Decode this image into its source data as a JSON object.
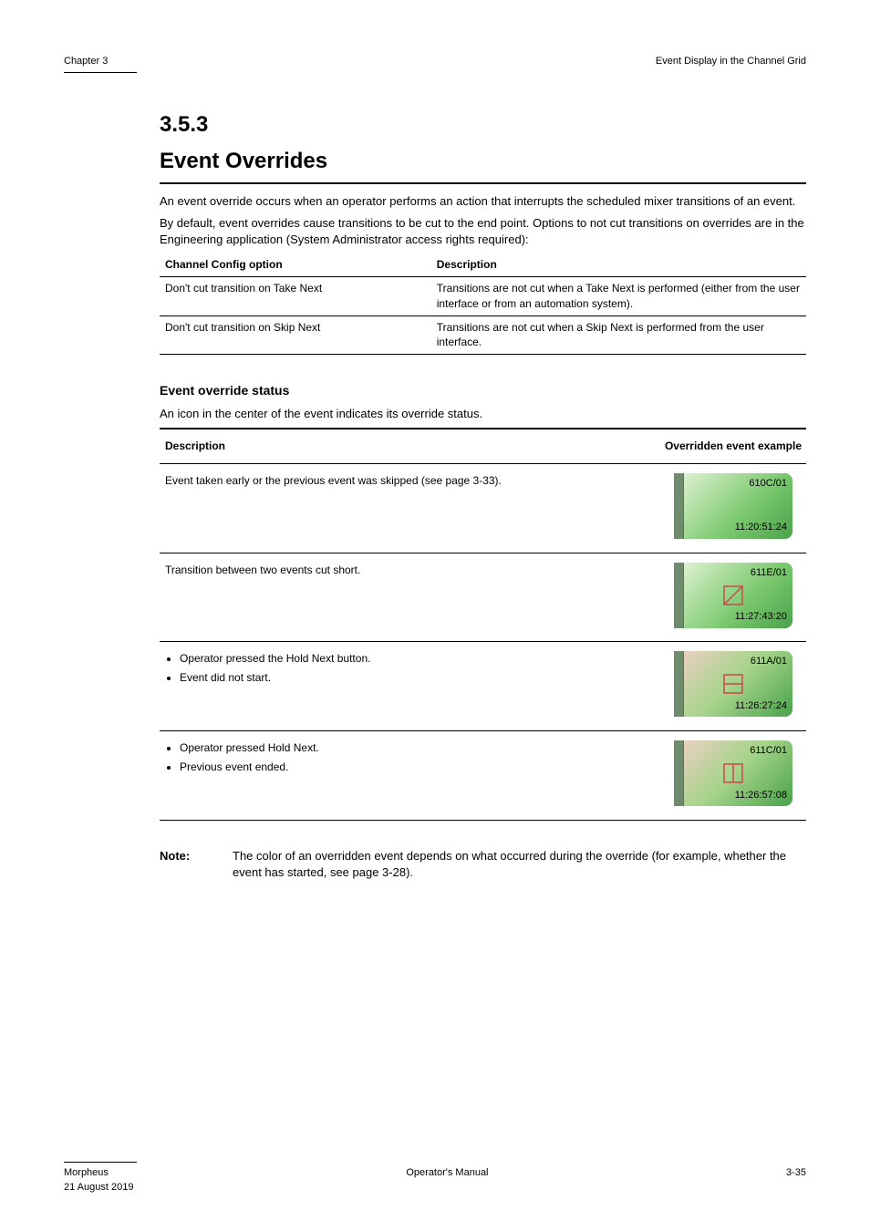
{
  "header": {
    "left": "Chapter 3",
    "right": "Event Display in the Channel Grid"
  },
  "section": {
    "number": "3.5.3",
    "title": "Event Overrides",
    "intro": "An event override occurs when an operator performs an action that interrupts the scheduled mixer transitions of an event.",
    "body": "By default, event overrides cause transitions to be cut to the end point. Options to not cut transitions on overrides are in the Engineering application (System Administrator access rights required):"
  },
  "opt_table": {
    "headers": [
      "Channel Config option",
      "Description"
    ],
    "rows": [
      [
        "Don't cut transition on Take Next",
        "Transitions are not cut when a Take Next is performed (either from the user interface or from an automation system)."
      ],
      [
        "Don't cut transition on Skip Next",
        "Transitions are not cut when a Skip Next is performed from the user interface."
      ]
    ]
  },
  "sub": {
    "title": "Event override status",
    "intro": "An icon in the center of the event indicates its override status.",
    "headers": [
      "Description",
      "Overridden event example"
    ],
    "rows": [
      {
        "desc_plain": "Event taken early or the previous event was skipped (see page 3-33).",
        "chip": {
          "style": "green",
          "title": "610C/01",
          "time": "11:20:51:24",
          "glyph": ""
        }
      },
      {
        "desc_plain": "Transition between two events cut short.",
        "chip": {
          "style": "green",
          "title": "611E/01",
          "time": "11:27:43:20",
          "glyph": "diag"
        }
      },
      {
        "desc_list": [
          "Operator pressed the Hold Next button.",
          "Event did not start."
        ],
        "chip": {
          "style": "redtint",
          "title": "611A/01",
          "time": "11:26:27:24",
          "glyph": "hsplit"
        }
      },
      {
        "desc_list": [
          "Operator pressed Hold Next.",
          "Previous event ended."
        ],
        "chip": {
          "style": "redtint",
          "title": "611C/01",
          "time": "11:26:57:08",
          "glyph": "vsplit"
        }
      }
    ]
  },
  "note": {
    "label": "Note:",
    "text": "The color of an overridden event depends on what occurred during the override (for example, whether the event has started, see page 3-28)."
  },
  "footer": {
    "left": "Morpheus",
    "center": "Operator's Manual",
    "right": "3-35",
    "date": "21 August 2019"
  }
}
